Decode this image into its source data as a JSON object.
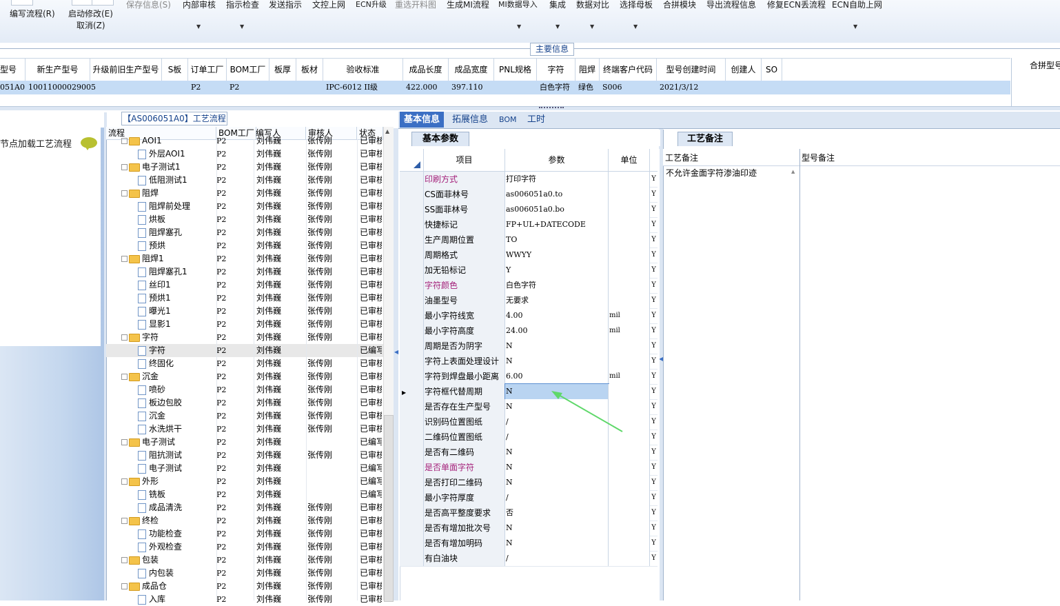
{
  "toolbar": {
    "items": [
      {
        "label": "编写流程(R)",
        "disabled": false
      },
      {
        "label": "启动修改(E)",
        "disabled": false
      },
      {
        "label": "取消(Z)",
        "disabled": false
      },
      {
        "label": "保存信息(S)",
        "disabled": true
      },
      {
        "label": "内部审核",
        "disabled": false
      },
      {
        "label": "指示检查",
        "disabled": false
      },
      {
        "label": "发送指示",
        "disabled": false
      },
      {
        "label": "文控上网",
        "disabled": false
      },
      {
        "label": "ECN升级",
        "disabled": false
      },
      {
        "label": "重选开料图",
        "disabled": true
      },
      {
        "label": "生成MI流程",
        "disabled": false
      },
      {
        "label": "MI数据导入",
        "disabled": false
      },
      {
        "label": "集成",
        "disabled": false
      },
      {
        "label": "数据对比",
        "disabled": false
      },
      {
        "label": "选择母板",
        "disabled": false
      },
      {
        "label": "合拼模块",
        "disabled": false
      },
      {
        "label": "导出流程信息",
        "disabled": false
      },
      {
        "label": "修复ECN丢流程",
        "disabled": false
      },
      {
        "label": "ECN自助上网",
        "disabled": false
      }
    ]
  },
  "main_info": {
    "title": "主要信息",
    "columns": [
      "型号",
      "新生产型号",
      "升级前旧生产型号",
      "S板",
      "订单工厂",
      "BOM工厂",
      "板厚",
      "板材",
      "验收标准",
      "成品长度",
      "成品宽度",
      "PNL规格",
      "字符",
      "阻焊",
      "终端客户代码",
      "型号创建时间",
      "创建人",
      "SO"
    ],
    "row": [
      "051A0",
      "10011000029005",
      "",
      "",
      "P2",
      "P2",
      "",
      "",
      "IPC-6012 II级",
      "422.000",
      "397.110",
      "",
      "白色字符",
      "绿色",
      "S006",
      "2021/3/12",
      "",
      ""
    ],
    "right_header": "合拼型号"
  },
  "left_panel": {
    "item": "节点加载工艺流程"
  },
  "process_tree": {
    "title": "【AS006051A0】工艺流程",
    "columns": [
      "流程",
      "BOM工厂",
      "编写人",
      "审核人",
      "状态"
    ],
    "rows": [
      {
        "name": "AOI1",
        "level": 1,
        "type": "folder",
        "bom": "P2",
        "writer": "刘伟巍",
        "reviewer": "张传刚",
        "status": "已审核"
      },
      {
        "name": "外层AOI1",
        "level": 2,
        "type": "file",
        "bom": "P2",
        "writer": "刘伟巍",
        "reviewer": "张传刚",
        "status": "已审核"
      },
      {
        "name": "电子测试1",
        "level": 1,
        "type": "folder",
        "bom": "P2",
        "writer": "刘伟巍",
        "reviewer": "张传刚",
        "status": "已审核"
      },
      {
        "name": "低阻测试1",
        "level": 2,
        "type": "file",
        "bom": "P2",
        "writer": "刘伟巍",
        "reviewer": "张传刚",
        "status": "已审核"
      },
      {
        "name": "阻焊",
        "level": 1,
        "type": "folder",
        "bom": "P2",
        "writer": "刘伟巍",
        "reviewer": "张传刚",
        "status": "已审核"
      },
      {
        "name": "阻焊前处理",
        "level": 2,
        "type": "file",
        "bom": "P2",
        "writer": "刘伟巍",
        "reviewer": "张传刚",
        "status": "已审核"
      },
      {
        "name": "烘板",
        "level": 2,
        "type": "file",
        "bom": "P2",
        "writer": "刘伟巍",
        "reviewer": "张传刚",
        "status": "已审核"
      },
      {
        "name": "阻焊塞孔",
        "level": 2,
        "type": "file",
        "bom": "P2",
        "writer": "刘伟巍",
        "reviewer": "张传刚",
        "status": "已审核"
      },
      {
        "name": "预烘",
        "level": 2,
        "type": "file",
        "bom": "P2",
        "writer": "刘伟巍",
        "reviewer": "张传刚",
        "status": "已审核"
      },
      {
        "name": "阻焊1",
        "level": 1,
        "type": "folder",
        "bom": "P2",
        "writer": "刘伟巍",
        "reviewer": "张传刚",
        "status": "已审核"
      },
      {
        "name": "阻焊塞孔1",
        "level": 2,
        "type": "file",
        "bom": "P2",
        "writer": "刘伟巍",
        "reviewer": "张传刚",
        "status": "已审核"
      },
      {
        "name": "丝印1",
        "level": 2,
        "type": "file",
        "bom": "P2",
        "writer": "刘伟巍",
        "reviewer": "张传刚",
        "status": "已审核"
      },
      {
        "name": "预烘1",
        "level": 2,
        "type": "file",
        "bom": "P2",
        "writer": "刘伟巍",
        "reviewer": "张传刚",
        "status": "已审核"
      },
      {
        "name": "曝光1",
        "level": 2,
        "type": "file",
        "bom": "P2",
        "writer": "刘伟巍",
        "reviewer": "张传刚",
        "status": "已审核"
      },
      {
        "name": "显影1",
        "level": 2,
        "type": "file",
        "bom": "P2",
        "writer": "刘伟巍",
        "reviewer": "张传刚",
        "status": "已审核"
      },
      {
        "name": "字符",
        "level": 1,
        "type": "folder",
        "bom": "P2",
        "writer": "刘伟巍",
        "reviewer": "张传刚",
        "status": "已审核"
      },
      {
        "name": "字符",
        "level": 2,
        "type": "file",
        "bom": "P2",
        "writer": "刘伟巍",
        "reviewer": "",
        "status": "已编写",
        "selected": true
      },
      {
        "name": "终固化",
        "level": 2,
        "type": "file",
        "bom": "P2",
        "writer": "刘伟巍",
        "reviewer": "张传刚",
        "status": "已审核"
      },
      {
        "name": "沉金",
        "level": 1,
        "type": "folder",
        "bom": "P2",
        "writer": "刘伟巍",
        "reviewer": "张传刚",
        "status": "已审核"
      },
      {
        "name": "喷砂",
        "level": 2,
        "type": "file",
        "bom": "P2",
        "writer": "刘伟巍",
        "reviewer": "张传刚",
        "status": "已审核"
      },
      {
        "name": "板边包胶",
        "level": 2,
        "type": "file",
        "bom": "P2",
        "writer": "刘伟巍",
        "reviewer": "张传刚",
        "status": "已审核"
      },
      {
        "name": "沉金",
        "level": 2,
        "type": "file",
        "bom": "P2",
        "writer": "刘伟巍",
        "reviewer": "张传刚",
        "status": "已审核"
      },
      {
        "name": "水洗烘干",
        "level": 2,
        "type": "file",
        "bom": "P2",
        "writer": "刘伟巍",
        "reviewer": "张传刚",
        "status": "已审核"
      },
      {
        "name": "电子测试",
        "level": 1,
        "type": "folder",
        "bom": "P2",
        "writer": "刘伟巍",
        "reviewer": "",
        "status": "已编写"
      },
      {
        "name": "阻抗测试",
        "level": 2,
        "type": "file",
        "bom": "P2",
        "writer": "刘伟巍",
        "reviewer": "张传刚",
        "status": "已审核"
      },
      {
        "name": "电子测试",
        "level": 2,
        "type": "file",
        "bom": "P2",
        "writer": "刘伟巍",
        "reviewer": "",
        "status": "已编写"
      },
      {
        "name": "外形",
        "level": 1,
        "type": "folder",
        "bom": "P2",
        "writer": "刘伟巍",
        "reviewer": "",
        "status": "已编写"
      },
      {
        "name": "铣板",
        "level": 2,
        "type": "file",
        "bom": "P2",
        "writer": "刘伟巍",
        "reviewer": "",
        "status": "已编写"
      },
      {
        "name": "成品清洗",
        "level": 2,
        "type": "file",
        "bom": "P2",
        "writer": "刘伟巍",
        "reviewer": "张传刚",
        "status": "已审核"
      },
      {
        "name": "终检",
        "level": 1,
        "type": "folder",
        "bom": "P2",
        "writer": "刘伟巍",
        "reviewer": "张传刚",
        "status": "已审核"
      },
      {
        "name": "功能检查",
        "level": 2,
        "type": "file",
        "bom": "P2",
        "writer": "刘伟巍",
        "reviewer": "张传刚",
        "status": "已审核"
      },
      {
        "name": "外观检查",
        "level": 2,
        "type": "file",
        "bom": "P2",
        "writer": "刘伟巍",
        "reviewer": "张传刚",
        "status": "已审核"
      },
      {
        "name": "包装",
        "level": 1,
        "type": "folder",
        "bom": "P2",
        "writer": "刘伟巍",
        "reviewer": "张传刚",
        "status": "已审核"
      },
      {
        "name": "内包装",
        "level": 2,
        "type": "file",
        "bom": "P2",
        "writer": "刘伟巍",
        "reviewer": "张传刚",
        "status": "已审核"
      },
      {
        "name": "成品仓",
        "level": 1,
        "type": "folder",
        "bom": "P2",
        "writer": "刘伟巍",
        "reviewer": "张传刚",
        "status": "已审核"
      },
      {
        "name": "入库",
        "level": 2,
        "type": "file",
        "bom": "P2",
        "writer": "刘伟巍",
        "reviewer": "张传刚",
        "status": "已审核"
      }
    ]
  },
  "tabs": [
    {
      "label": "基本信息",
      "active": true
    },
    {
      "label": "拓展信息",
      "active": false
    },
    {
      "label": "BOM",
      "active": false
    },
    {
      "label": "工时",
      "active": false
    }
  ],
  "params": {
    "subtab": "基本参数",
    "columns": [
      "项目",
      "参数",
      "单位"
    ],
    "rows": [
      {
        "key": "印刷方式",
        "value": "打印字符",
        "unit": "",
        "flag": "Y",
        "pink": true
      },
      {
        "key": "CS面菲林号",
        "value": "as006051a0.to",
        "unit": "",
        "flag": "Y"
      },
      {
        "key": "SS面菲林号",
        "value": "as006051a0.bo",
        "unit": "",
        "flag": "Y"
      },
      {
        "key": "快捷标记",
        "value": "FP+UL+DATECODE",
        "unit": "",
        "flag": "Y"
      },
      {
        "key": "生产周期位置",
        "value": "TO",
        "unit": "",
        "flag": "Y"
      },
      {
        "key": "周期格式",
        "value": "WWYY",
        "unit": "",
        "flag": "Y"
      },
      {
        "key": "加无铅标记",
        "value": "Y",
        "unit": "",
        "flag": "Y"
      },
      {
        "key": "字符颜色",
        "value": "白色字符",
        "unit": "",
        "flag": "Y",
        "pink": true
      },
      {
        "key": "油墨型号",
        "value": "无要求",
        "unit": "",
        "flag": "Y"
      },
      {
        "key": "最小字符线宽",
        "value": "4.00",
        "unit": "mil",
        "flag": "Y"
      },
      {
        "key": "最小字符高度",
        "value": "24.00",
        "unit": "mil",
        "flag": "Y"
      },
      {
        "key": "周期是否为阴字",
        "value": "N",
        "unit": "",
        "flag": "Y"
      },
      {
        "key": "字符上表面处理设计",
        "value": "N",
        "unit": "",
        "flag": "Y"
      },
      {
        "key": "字符到焊盘最小距离",
        "value": "6.00",
        "unit": "mil",
        "flag": "Y"
      },
      {
        "key": "字符框代替周期",
        "value": "N",
        "unit": "",
        "flag": "Y",
        "selected": true
      },
      {
        "key": "是否存在生产型号",
        "value": "N",
        "unit": "",
        "flag": "Y"
      },
      {
        "key": "识别码位置图纸",
        "value": "/",
        "unit": "",
        "flag": "Y"
      },
      {
        "key": "二维码位置图纸",
        "value": "/",
        "unit": "",
        "flag": "Y"
      },
      {
        "key": "是否有二维码",
        "value": "N",
        "unit": "",
        "flag": "Y"
      },
      {
        "key": "是否单面字符",
        "value": "N",
        "unit": "",
        "flag": "Y",
        "pink": true
      },
      {
        "key": "是否打印二维码",
        "value": "N",
        "unit": "",
        "flag": "Y"
      },
      {
        "key": "最小字符厚度",
        "value": "/",
        "unit": "",
        "flag": "Y"
      },
      {
        "key": "是否高平整度要求",
        "value": "否",
        "unit": "",
        "flag": "Y"
      },
      {
        "key": "是否有增加批次号",
        "value": "N",
        "unit": "",
        "flag": "Y"
      },
      {
        "key": "是否有增加明码",
        "value": "N",
        "unit": "",
        "flag": "Y"
      },
      {
        "key": "有白油块",
        "value": "/",
        "unit": "",
        "flag": "Y"
      }
    ]
  },
  "notes": {
    "subtab": "工艺备注",
    "col1": "工艺备注",
    "col2": "型号备注",
    "content": "不允许金面字符渗油印迹"
  },
  "colors": {
    "accent": "#3b6fc4",
    "arrow": "#5fd86a",
    "pink": "#a4207a",
    "selection": "#c5dcf5"
  }
}
